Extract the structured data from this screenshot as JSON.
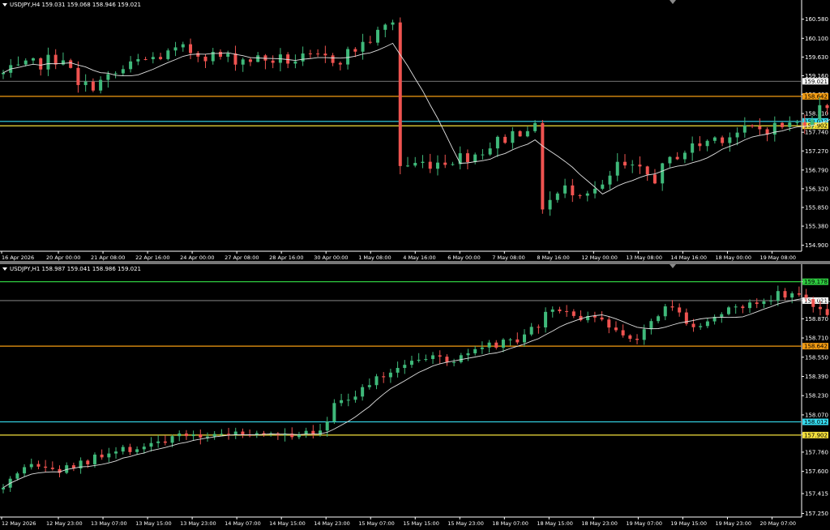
{
  "panes": [
    {
      "header": "USDJPY,H4  159.031 159.068 158.946 159.021",
      "chart_data": {
        "type": "candlestick",
        "symbol": "USDJPY",
        "timeframe": "H4",
        "ohlc_header": {
          "open": 159.031,
          "high": 159.068,
          "low": 158.946,
          "close": 159.021
        },
        "ylim": [
          154.75,
          160.9
        ],
        "y_ticks": [
          160.58,
          160.1,
          159.63,
          159.16,
          158.69,
          158.21,
          157.74,
          157.27,
          156.79,
          156.32,
          155.85,
          155.38,
          154.9
        ],
        "x_labels": [
          "16 Apr 2026",
          "20 Apr 00:00",
          "21 Apr 08:00",
          "22 Apr 16:00",
          "24 Apr 00:00",
          "27 Apr 08:00",
          "28 Apr 16:00",
          "30 Apr 00:00",
          "1 May 08:00",
          "4 May 16:00",
          "6 May 00:00",
          "7 May 08:00",
          "8 May 16:00",
          "12 May 00:00",
          "13 May 08:00",
          "14 May 16:00",
          "18 May 00:00",
          "19 May 08:00"
        ],
        "lines": [
          {
            "value": 159.021,
            "label": "159.021",
            "color": "#9a9a9a",
            "label_bg": "#ffffff",
            "label_fg": "#000000"
          },
          {
            "value": 158.642,
            "label": "158.642",
            "color": "#f39c12",
            "label_bg": "#f39c12",
            "label_fg": "#000000"
          },
          {
            "value": 158.012,
            "label": "158.012",
            "color": "#35d9ec",
            "label_bg": "#35d9ec",
            "label_fg": "#000000"
          },
          {
            "value": 157.902,
            "label": "157.902",
            "color": "#f4e03c",
            "label_bg": "#f4e03c",
            "label_fg": "#000000"
          }
        ],
        "key_points": [
          {
            "x": 0,
            "y": 159.2
          },
          {
            "x": 8,
            "y": 159.65
          },
          {
            "x": 10,
            "y": 158.85
          },
          {
            "x": 13,
            "y": 159.0
          },
          {
            "x": 18,
            "y": 159.5
          },
          {
            "x": 24,
            "y": 159.8
          },
          {
            "x": 30,
            "y": 159.6
          },
          {
            "x": 38,
            "y": 159.55
          },
          {
            "x": 45,
            "y": 159.6
          },
          {
            "x": 50,
            "y": 160.2
          },
          {
            "x": 52,
            "y": 160.55
          },
          {
            "x": 53,
            "y": 156.9
          },
          {
            "x": 58,
            "y": 157.0
          },
          {
            "x": 63,
            "y": 157.2
          },
          {
            "x": 70,
            "y": 157.9
          },
          {
            "x": 71,
            "y": 157.8
          },
          {
            "x": 72,
            "y": 155.9
          },
          {
            "x": 75,
            "y": 156.3
          },
          {
            "x": 80,
            "y": 156.3
          },
          {
            "x": 82,
            "y": 156.9
          },
          {
            "x": 87,
            "y": 156.6
          },
          {
            "x": 90,
            "y": 157.2
          },
          {
            "x": 95,
            "y": 157.6
          },
          {
            "x": 100,
            "y": 157.8
          },
          {
            "x": 106,
            "y": 157.95
          },
          {
            "x": 110,
            "y": 158.45
          },
          {
            "x": 114,
            "y": 158.75
          },
          {
            "x": 118,
            "y": 158.9
          },
          {
            "x": 122,
            "y": 159.05
          },
          {
            "x": 126,
            "y": 159.02
          }
        ]
      }
    },
    {
      "header": "USDJPY,H1  158.987 159.041 158.986 159.021",
      "chart_data": {
        "type": "candlestick",
        "symbol": "USDJPY",
        "timeframe": "H1",
        "ohlc_header": {
          "open": 158.987,
          "high": 159.041,
          "low": 158.986,
          "close": 159.021
        },
        "ylim": [
          157.22,
          159.27
        ],
        "y_ticks": [
          159.178,
          159.021,
          158.87,
          158.71,
          158.55,
          158.39,
          158.23,
          158.07,
          157.91,
          157.76,
          157.6,
          157.415,
          157.25
        ],
        "x_labels": [
          "12 May 2026",
          "12 May 23:00",
          "13 May 07:00",
          "13 May 15:00",
          "13 May 23:00",
          "14 May 07:00",
          "14 May 15:00",
          "14 May 23:00",
          "15 May 07:00",
          "15 May 15:00",
          "15 May 23:00",
          "18 May 07:00",
          "18 May 15:00",
          "18 May 23:00",
          "19 May 07:00",
          "19 May 15:00",
          "19 May 23:00",
          "20 May 07:00"
        ],
        "lines": [
          {
            "value": 159.178,
            "label": "159.178",
            "color": "#2ecc40",
            "label_bg": "#2ecc40",
            "label_fg": "#000000"
          },
          {
            "value": 159.021,
            "label": "159.021",
            "color": "#9a9a9a",
            "label_bg": "#ffffff",
            "label_fg": "#000000"
          },
          {
            "value": 158.642,
            "label": "158.642",
            "color": "#f39c12",
            "label_bg": "#f39c12",
            "label_fg": "#000000"
          },
          {
            "value": 158.012,
            "label": "158.012",
            "color": "#35d9ec",
            "label_bg": "#35d9ec",
            "label_fg": "#000000"
          },
          {
            "value": 157.902,
            "label": "157.902",
            "color": "#f4e03c",
            "label_bg": "#f4e03c",
            "label_fg": "#000000"
          }
        ],
        "key_points": [
          {
            "x": 0,
            "y": 157.45
          },
          {
            "x": 4,
            "y": 157.65
          },
          {
            "x": 8,
            "y": 157.6
          },
          {
            "x": 14,
            "y": 157.72
          },
          {
            "x": 22,
            "y": 157.85
          },
          {
            "x": 30,
            "y": 157.92
          },
          {
            "x": 38,
            "y": 157.9
          },
          {
            "x": 45,
            "y": 157.95
          },
          {
            "x": 47,
            "y": 158.15
          },
          {
            "x": 52,
            "y": 158.32
          },
          {
            "x": 58,
            "y": 158.55
          },
          {
            "x": 64,
            "y": 158.52
          },
          {
            "x": 68,
            "y": 158.62
          },
          {
            "x": 74,
            "y": 158.7
          },
          {
            "x": 78,
            "y": 158.95
          },
          {
            "x": 84,
            "y": 158.85
          },
          {
            "x": 90,
            "y": 158.72
          },
          {
            "x": 94,
            "y": 159.0
          },
          {
            "x": 98,
            "y": 158.82
          },
          {
            "x": 104,
            "y": 158.95
          },
          {
            "x": 110,
            "y": 159.08
          },
          {
            "x": 114,
            "y": 159.05
          },
          {
            "x": 118,
            "y": 158.85
          },
          {
            "x": 124,
            "y": 159.02
          },
          {
            "x": 128,
            "y": 158.92
          },
          {
            "x": 134,
            "y": 159.02
          }
        ]
      }
    }
  ],
  "colors": {
    "bull": "#26a69a",
    "bull_fill": "#3fb97a",
    "bear": "#ef5350",
    "grid_axis": "#ffffff",
    "ma": "#e0e0e0"
  }
}
